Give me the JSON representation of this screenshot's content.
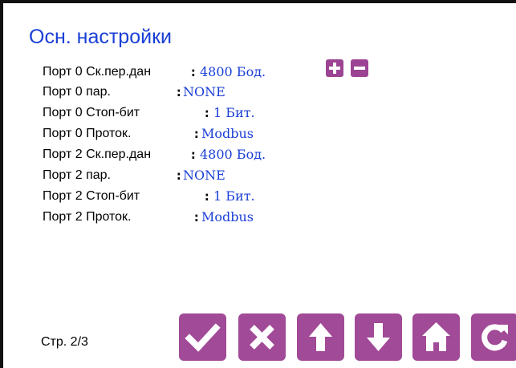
{
  "title": "Осн. настройки",
  "rows": [
    {
      "label": "Порт 0 Ск.пер.дан",
      "colon": ":",
      "value": "4800 Бод."
    },
    {
      "label": "Порт 0 пар.",
      "colon": ":",
      "value": "NONE"
    },
    {
      "label": "Порт 0 Стоп-бит",
      "colon": ":",
      "value": "1 Бит."
    },
    {
      "label": "Порт 0 Проток.",
      "colon": ":",
      "value": "Modbus"
    },
    {
      "label": "Порт 2 Ск.пер.дан",
      "colon": ":",
      "value": "4800 Бод."
    },
    {
      "label": "Порт 2 пар.",
      "colon": ":",
      "value": "NONE"
    },
    {
      "label": "Порт 2 Стоп-бит",
      "colon": ":",
      "value": "1 Бит."
    },
    {
      "label": "Порт 2 Проток.",
      "colon": ":",
      "value": "Modbus"
    }
  ],
  "adjust_buttons": [
    {
      "icon": "plus-icon"
    },
    {
      "icon": "minus-icon"
    }
  ],
  "page_indicator": "Стр. 2/3",
  "nav_buttons": [
    {
      "icon": "check-icon"
    },
    {
      "icon": "close-icon"
    },
    {
      "icon": "arrow-up-icon"
    },
    {
      "icon": "arrow-down-icon"
    },
    {
      "icon": "home-icon"
    },
    {
      "icon": "refresh-icon"
    }
  ],
  "colors": {
    "title": "#1a3fd6",
    "value": "#1a3fd6",
    "button": "#a14a97",
    "frame": "#111111"
  }
}
